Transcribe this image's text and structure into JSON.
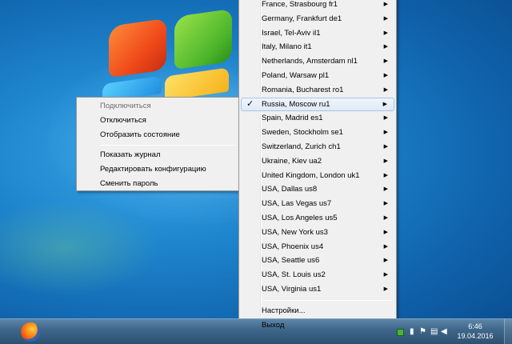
{
  "left_menu": {
    "items": [
      {
        "label": "Подключиться",
        "disabled": true
      },
      {
        "label": "Отключиться"
      },
      {
        "label": "Отобразить состояние"
      }
    ],
    "items2": [
      {
        "label": "Показать журнал"
      },
      {
        "label": "Редактировать конфигурацию"
      },
      {
        "label": "Сменить пароль"
      }
    ]
  },
  "server_menu": {
    "items": [
      {
        "label": "France, Strasbourg fr1"
      },
      {
        "label": "Germany, Frankfurt de1"
      },
      {
        "label": "Israel, Tel-Aviv il1"
      },
      {
        "label": "Italy, Milano it1"
      },
      {
        "label": "Netherlands, Amsterdam nl1"
      },
      {
        "label": "Poland, Warsaw pl1"
      },
      {
        "label": "Romania, Bucharest ro1"
      },
      {
        "label": "Russia, Moscow ru1",
        "checked": true
      },
      {
        "label": "Spain, Madrid es1"
      },
      {
        "label": "Sweden, Stockholm se1"
      },
      {
        "label": "Switzerland, Zurich ch1"
      },
      {
        "label": "Ukraine, Kiev ua2"
      },
      {
        "label": "United Kingdom, London uk1"
      },
      {
        "label": "USA, Dallas us8"
      },
      {
        "label": "USA, Las Vegas us7"
      },
      {
        "label": "USA, Los Angeles us5"
      },
      {
        "label": "USA, New York us3"
      },
      {
        "label": "USA, Phoenix us4"
      },
      {
        "label": "USA, Seattle us6"
      },
      {
        "label": "USA, St. Louis us2"
      },
      {
        "label": "USA, Virginia us1"
      }
    ],
    "settings_label": "Настройки...",
    "exit_label": "Выход",
    "check_glyph": "✓",
    "submenu_glyph": "▶"
  },
  "taskbar": {
    "time": "6:46",
    "date": "19.04.2016",
    "icons": [
      "firefox-icon",
      "flag-icon",
      "network-icon",
      "volume-icon"
    ]
  }
}
